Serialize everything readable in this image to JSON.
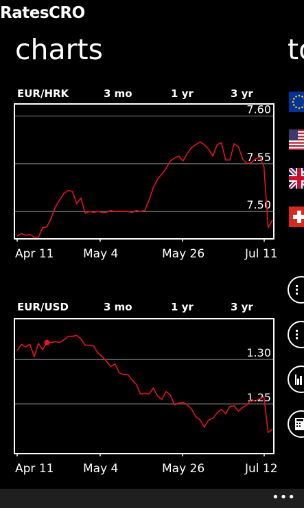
{
  "app": {
    "title": "RatesCRO"
  },
  "pivot": {
    "current": "charts",
    "next": "to"
  },
  "range_tabs": [
    "3 mo",
    "1 yr",
    "3 yr"
  ],
  "colors": {
    "line": "#e8141b",
    "grid": "#888888",
    "frame": "#ffffff",
    "background": "#000000"
  },
  "flags": [
    "eu-flag",
    "us-flag",
    "uk-flag",
    "swiss-flag"
  ],
  "side_buttons": [
    "list-icon",
    "list-icon",
    "bar-chart-icon",
    "calculator-icon"
  ],
  "app_bar": {
    "more": "•••"
  },
  "chart_data": [
    {
      "type": "line",
      "title": "EUR/HRK",
      "x_labels": [
        "Apr 11",
        "May 4",
        "May 26",
        "Jul 11"
      ],
      "y_ticks": [
        7.5,
        7.55,
        7.6
      ],
      "y_tick_labels": [
        "7.50",
        "7.55",
        "7.60"
      ],
      "ylim": [
        7.472,
        7.612
      ],
      "values": [
        7.474,
        7.477,
        7.475,
        7.476,
        7.473,
        7.473,
        7.483,
        7.484,
        7.493,
        7.505,
        7.512,
        7.519,
        7.522,
        7.521,
        7.508,
        7.514,
        7.498,
        7.5,
        7.499,
        7.5,
        7.499,
        7.499,
        7.501,
        7.5,
        7.5,
        7.5,
        7.5,
        7.499,
        7.501,
        7.5,
        7.501,
        7.512,
        7.525,
        7.534,
        7.539,
        7.545,
        7.553,
        7.556,
        7.558,
        7.553,
        7.561,
        7.567,
        7.57,
        7.573,
        7.57,
        7.565,
        7.558,
        7.57,
        7.572,
        7.554,
        7.554,
        7.571,
        7.568,
        7.555,
        7.55,
        7.551,
        7.555,
        7.557,
        7.547,
        7.483,
        7.491
      ],
      "grid": true,
      "marker_index": null
    },
    {
      "type": "line",
      "title": "EUR/USD",
      "x_labels": [
        "Apr 11",
        "May 4",
        "May 26",
        "Jul 12"
      ],
      "y_ticks": [
        1.25,
        1.3
      ],
      "y_tick_labels": [
        "1.25",
        "1.30"
      ],
      "ylim": [
        1.195,
        1.345
      ],
      "values": [
        1.31,
        1.317,
        1.314,
        1.317,
        1.303,
        1.318,
        1.311,
        1.319,
        1.319,
        1.32,
        1.319,
        1.322,
        1.326,
        1.326,
        1.327,
        1.323,
        1.316,
        1.316,
        1.315,
        1.307,
        1.303,
        1.298,
        1.292,
        1.295,
        1.285,
        1.283,
        1.283,
        1.277,
        1.272,
        1.261,
        1.262,
        1.261,
        1.268,
        1.259,
        1.255,
        1.264,
        1.26,
        1.249,
        1.251,
        1.252,
        1.249,
        1.244,
        1.236,
        1.232,
        1.224,
        1.232,
        1.234,
        1.24,
        1.244,
        1.239,
        1.247,
        1.248,
        1.242,
        1.246,
        1.249,
        1.255,
        1.253,
        1.256,
        1.258,
        1.218,
        1.222
      ],
      "grid": true,
      "marker_index": 7
    }
  ]
}
